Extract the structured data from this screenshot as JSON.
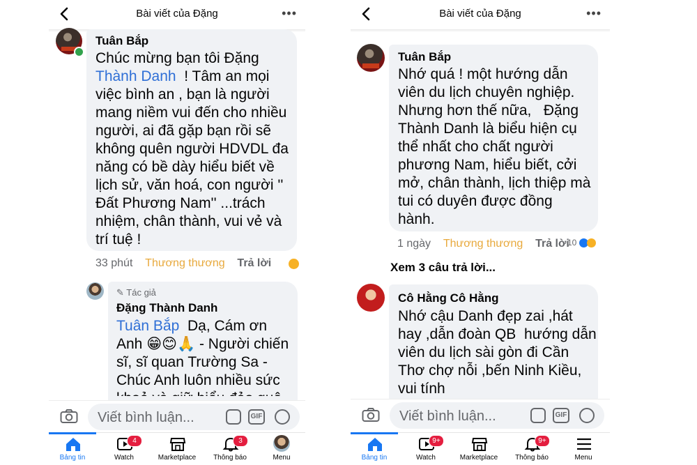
{
  "left": {
    "header": {
      "title": "Bài viết của Đặng"
    },
    "comment1": {
      "author": "Tuân Bắp",
      "line1": "Chúc mừng bạn tôi Đặng",
      "mention": "Thành Danh",
      "lines": [
        "! Tâm an mọi",
        "việc bình an , bạn là người",
        "mang niềm vui đến cho nhiều",
        "người, ai đã gặp bạn rồi sẽ",
        "không quên người HDVDL đa",
        "năng có bề dày hiểu biết về",
        "lịch sử, văn hoá, con người ''",
        "Đất Phương Nam'' ...trách",
        "nhiệm, chân thành, vui vẻ và",
        "trí tuệ !"
      ],
      "time": "33 phút",
      "react_label": "Thương thương",
      "reply_label": "Trả lời"
    },
    "reply1": {
      "author_tag": "Tác giả",
      "author": "Đặng Thành Danh",
      "mention": "Tuân Bắp",
      "lines": [
        "Dạ, Cám ơn",
        "Anh 😁😊🙏 - Người chiến",
        "sĩ, sĩ quan Trường Sa -",
        "Chúc Anh luôn nhiều sức",
        "khoẻ và giữ hiểu đảo quê"
      ]
    },
    "input": {
      "placeholder": "Viết bình luận..."
    },
    "tabs": [
      {
        "label": "Bảng tin",
        "badge": ""
      },
      {
        "label": "Watch",
        "badge": "4"
      },
      {
        "label": "Marketplace",
        "badge": ""
      },
      {
        "label": "Thông báo",
        "badge": "3"
      },
      {
        "label": "Menu",
        "badge": ""
      }
    ]
  },
  "right": {
    "header": {
      "title": "Bài viết của Đặng"
    },
    "comment1": {
      "author": "Tuân Bắp",
      "lines": [
        "Nhớ quá ! một hướng dẫn",
        "viên du lịch chuyên nghiệp.",
        "Nhưng hơn thế nữa,   Đặng",
        "Thành Danh là biểu hiện cụ",
        "thể nhất cho chất người",
        "phương Nam, hiểu biết, cởi",
        "mở, chân thành, lịch thiệp mà",
        "tui có duyên được đồng",
        "hành."
      ],
      "time": "1 ngày",
      "react_label": "Thương thương",
      "reply_label": "Trả lời",
      "reaction_count": "10"
    },
    "view_replies": "Xem 3 câu trả lời...",
    "comment2": {
      "author": "Cô Hằng Cô Hằng",
      "lines": [
        "Nhớ cậu Danh đẹp zai ,hát",
        "hay ,dẫn đoàn QB  hướng dẫn",
        "viên du lịch sài gòn đi Cần",
        "Thơ chợ nỗi ,bến Ninh Kiều,",
        "vui tính"
      ]
    },
    "input": {
      "placeholder": "Viết bình luận..."
    },
    "tabs": [
      {
        "label": "Bảng tin",
        "badge": ""
      },
      {
        "label": "Watch",
        "badge": "9+"
      },
      {
        "label": "Marketplace",
        "badge": ""
      },
      {
        "label": "Thông báo",
        "badge": "9+"
      },
      {
        "label": "Menu",
        "badge": ""
      }
    ]
  },
  "colors": {
    "accent": "#1877f2",
    "mention": "#2f6fd6",
    "react": "#e8a93c",
    "badge": "#e41e3f",
    "bubble": "#f0f2f5"
  },
  "icons": [
    "back-arrow-icon",
    "more-icon",
    "camera-icon",
    "sticker-icon",
    "gif-icon",
    "emoji-icon",
    "home-icon",
    "watch-icon",
    "marketplace-icon",
    "bell-icon",
    "menu-icon"
  ]
}
